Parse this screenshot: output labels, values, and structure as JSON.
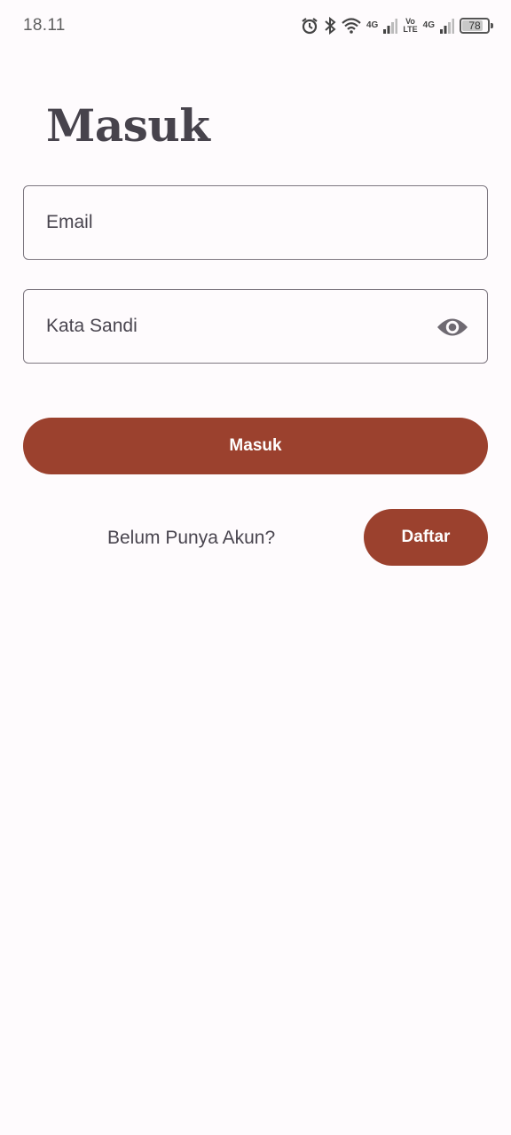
{
  "status_bar": {
    "time": "18.11",
    "network_1": "4G",
    "volte_top": "Vo",
    "volte_bottom": "LTE",
    "network_2": "4G",
    "battery_level": "78"
  },
  "title": "Masuk",
  "form": {
    "email_placeholder": "Email",
    "password_placeholder": "Kata Sandi",
    "submit_label": "Masuk"
  },
  "register": {
    "prompt": "Belum Punya Akun?",
    "button_label": "Daftar"
  },
  "colors": {
    "primary": "#9b412e",
    "background": "#fefbfd",
    "outline": "#7d7780",
    "text": "#49454f"
  }
}
